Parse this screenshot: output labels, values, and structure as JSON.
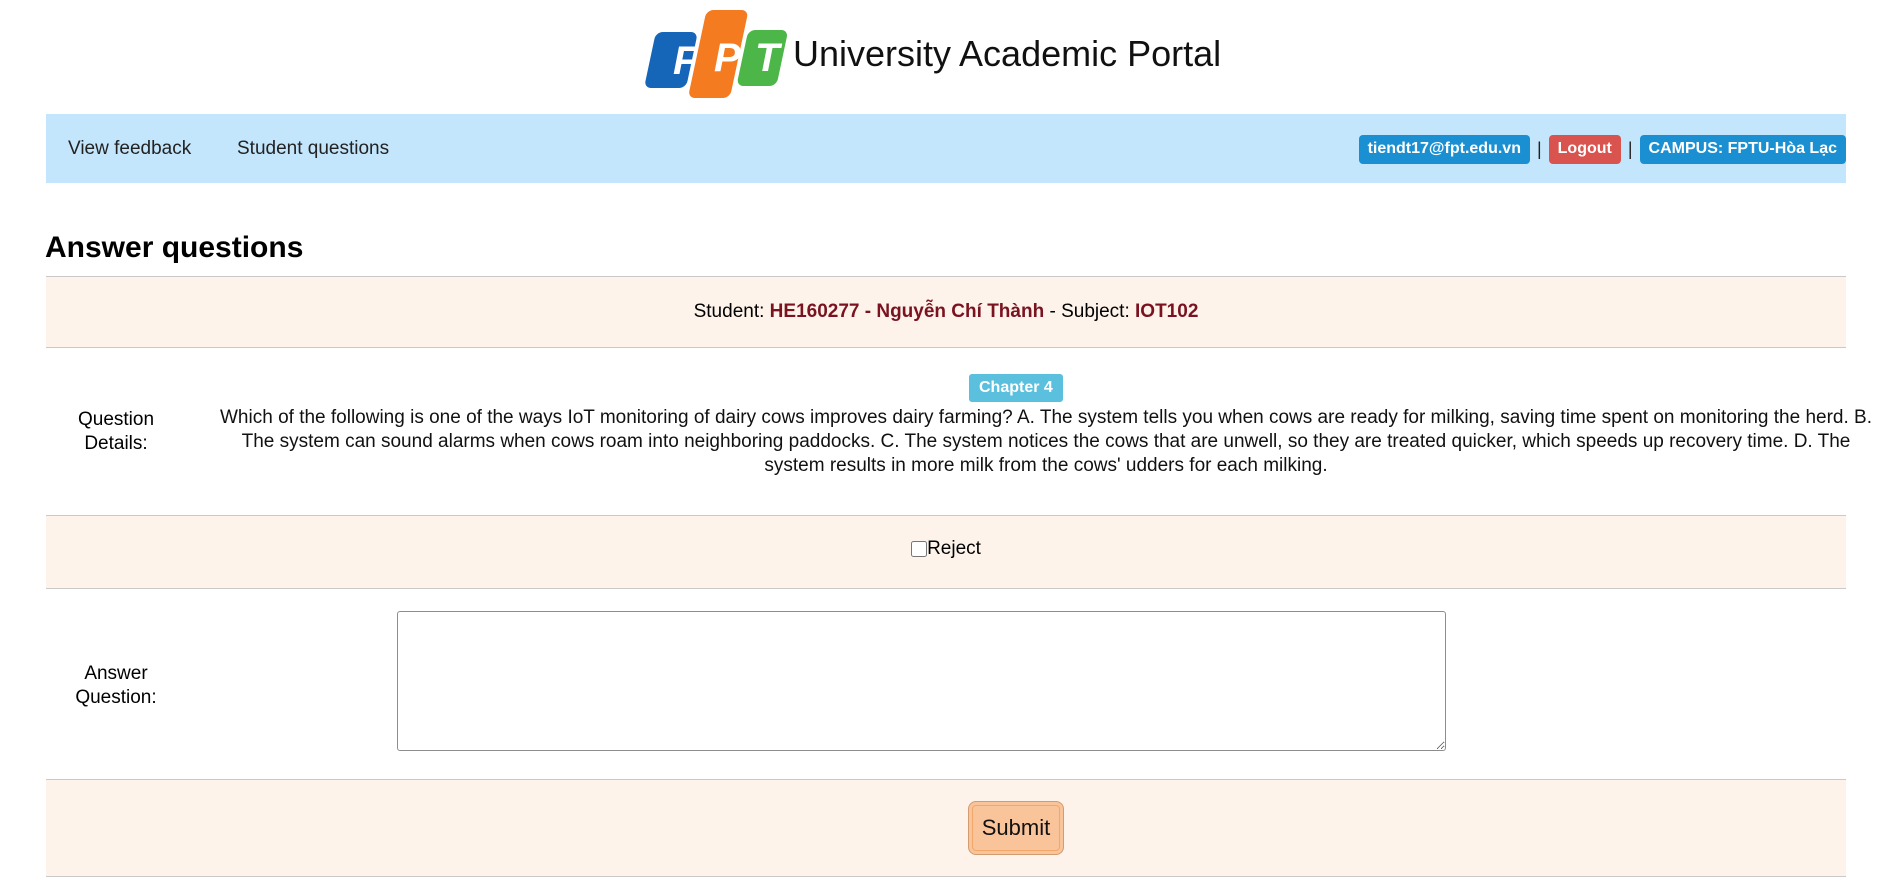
{
  "header": {
    "logo_letters": [
      "F",
      "P",
      "T"
    ],
    "title": "University Academic Portal"
  },
  "nav": {
    "links": [
      "View feedback",
      "Student questions"
    ],
    "user_email": "tiendt17@fpt.edu.vn",
    "logout_label": "Logout",
    "separator": "|",
    "campus_label": "CAMPUS: FPTU-Hòa Lạc"
  },
  "page": {
    "title": "Answer questions"
  },
  "student_row": {
    "student_prefix": "Student:",
    "student_value": "HE160277 - Nguyễn Chí Thành",
    "dash": "-",
    "subject_prefix": "Subject:",
    "subject_value": "IOT102"
  },
  "question_row": {
    "label": "Question Details:",
    "chapter": "Chapter 4",
    "text": "Which of the following is one of the ways IoT monitoring of dairy cows improves dairy farming? A. The system tells you when cows are ready for milking, saving time spent on monitoring the herd. B. The system can sound alarms when cows roam into neighboring paddocks. C. The system notices the cows that are unwell, so they are treated quicker, which speeds up recovery time. D. The system results in more milk from the cows' udders for each milking."
  },
  "reject_row": {
    "label": "Reject",
    "checked": false
  },
  "answer_row": {
    "label": "Answer Question:",
    "value": "",
    "placeholder": ""
  },
  "submit_row": {
    "button_label": "Submit"
  },
  "colors": {
    "nav_bg": "#c4e6fc",
    "label_blue": "#1a8fd1",
    "label_red": "#d9534f",
    "row_alt_bg": "#fdf3ea",
    "accent_dark_red": "#7a1220",
    "chapter_badge": "#5bc0de",
    "submit_bg": "#fac49b",
    "logo_blue": "#1565b8",
    "logo_orange": "#f47b20",
    "logo_green": "#4cb649"
  }
}
